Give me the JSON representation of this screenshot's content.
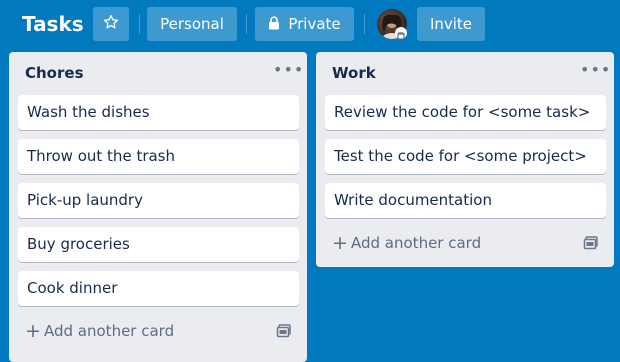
{
  "board": {
    "title": "Tasks",
    "visibility_personal": "Personal",
    "visibility_private": "Private",
    "invite_label": "Invite"
  },
  "lists": [
    {
      "title": "Chores",
      "cards": [
        "Wash the dishes",
        "Throw out the trash",
        "Pick-up laundry",
        "Buy groceries",
        "Cook dinner"
      ],
      "add_card_label": "Add another card"
    },
    {
      "title": "Work",
      "cards": [
        "Review the code for <some task>",
        "Test the code for <some project>",
        "Write documentation"
      ],
      "add_card_label": "Add another card"
    }
  ],
  "icons": {
    "star": "star-icon",
    "lock": "lock-icon",
    "menu": "more-horizontal-icon",
    "plus": "plus-icon",
    "template": "card-template-icon"
  },
  "colors": {
    "board_background": "#0079bf",
    "list_background": "#ebecf0",
    "card_background": "#ffffff",
    "text_primary": "#172b4d",
    "text_muted": "#5e6c84"
  }
}
